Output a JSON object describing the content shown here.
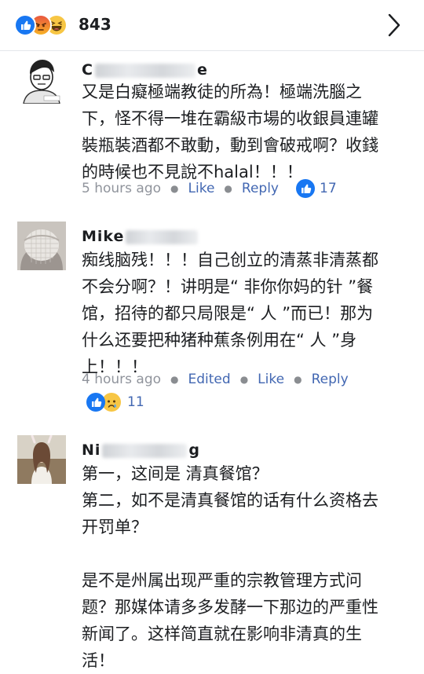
{
  "header": {
    "reaction_count": "843",
    "reaction_icons": [
      "like-icon",
      "angry-icon",
      "haha-icon"
    ]
  },
  "comments": [
    {
      "name_visible": [
        "C",
        "e"
      ],
      "text": "又是白癡極端教徒的所為！極端洗腦之\n下，怪不得一堆在霸級市場的收銀員連罐\n裝瓶裝酒都不敢動，動到會破戒啊？收錢\n的時候也不見說不halal！！！",
      "time": "5 hours ago",
      "actions": [
        "Like",
        "Reply"
      ],
      "reaction_count": "17",
      "reaction_icons": [
        "like-icon"
      ]
    },
    {
      "name_visible": [
        "Mike"
      ],
      "text": "痴线脑残！！！自己创立的清蒸非清蒸都\n不会分啊？！讲明是“ 非你你妈的针 ”餐\n馆，招待的都只局限是“ 人 ”而已！那为\n什么还要把种猪种蕉条例用在“ 人 ”身\n上！！！",
      "time": "4 hours ago",
      "actions": [
        "Edited",
        "Like",
        "Reply"
      ],
      "reaction_count": "11",
      "reaction_icons": [
        "like-icon",
        "sad-icon"
      ]
    },
    {
      "name_visible": [
        "Ni",
        "g"
      ],
      "text": "第一，这间是 清真餐馆？\n第二，如不是清真餐馆的话有什么资格去\n开罚单？\n\n是不是州属出现严重的宗教管理方式问\n题？那媒体请多多发酵一下那边的严重性\n新闻了。这样简直就在影响非清真的生\n活！"
    }
  ],
  "colors": {
    "like_blue": "#1877f2",
    "link_blue": "#4267b2",
    "meta_gray": "#90949c",
    "divider": "#e4e6eb"
  }
}
